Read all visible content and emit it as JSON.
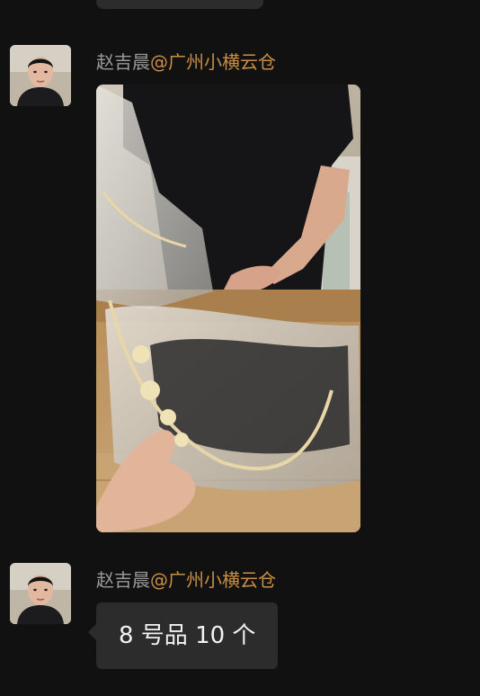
{
  "messages": [
    {
      "sender_name": "赵吉晨",
      "sender_tag": "@广州小横云仓",
      "type": "image",
      "image_alt": "photo"
    },
    {
      "sender_name": "赵吉晨",
      "sender_tag": "@广州小横云仓",
      "type": "text",
      "text": "8 号品 10 个"
    }
  ],
  "colors": {
    "background": "#111111",
    "bubble": "#2c2c2c",
    "name": "#9a9a9a",
    "tag": "#c98f45"
  }
}
